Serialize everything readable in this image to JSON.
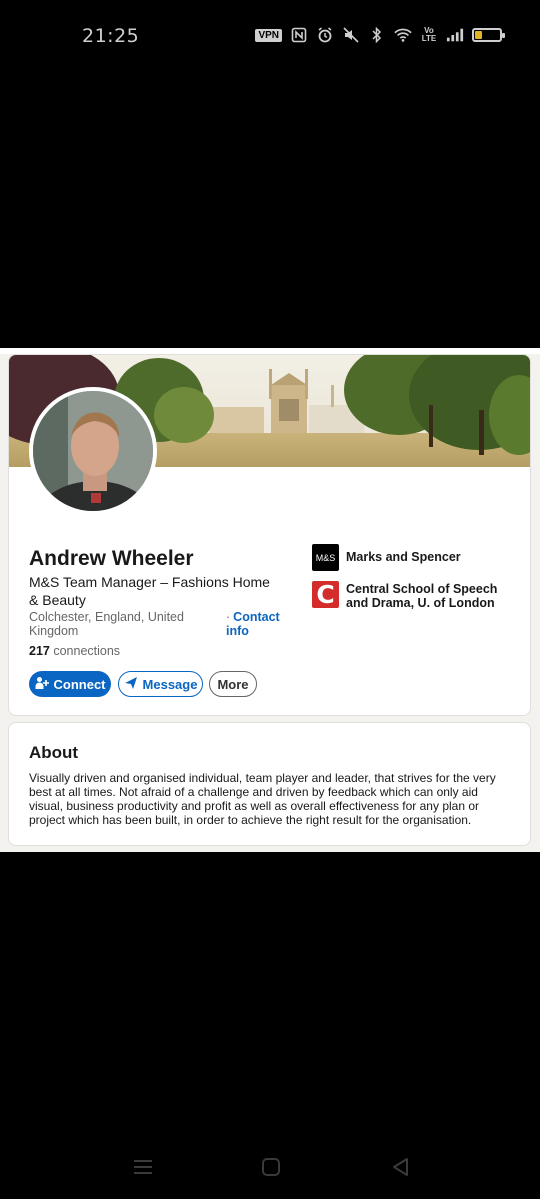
{
  "status_bar": {
    "time": "21:25",
    "vpn_label": "VPN",
    "battery_level_fraction": 0.3,
    "battery_color": "#e0b424",
    "icons": [
      "nfc-icon",
      "alarm-icon",
      "mute-icon",
      "bluetooth-icon",
      "wifi-icon",
      "volte-icon",
      "signal-icon",
      "battery-icon"
    ]
  },
  "profile": {
    "name": "Andrew Wheeler",
    "headline": "M&S Team Manager – Fashions Home & Beauty",
    "location": "Colchester, England, United Kingdom",
    "contact_dot": "·",
    "contact_info_label": "Contact info",
    "connections_count": "217",
    "connections_label": "connections",
    "actions": {
      "connect": "Connect",
      "message": "Message",
      "more": "More"
    },
    "experience": [
      {
        "logo_text": "M&S",
        "name": "Marks and Spencer"
      },
      {
        "logo_text": "C",
        "name": "Central School of Speech and Drama, U. of London"
      }
    ]
  },
  "about": {
    "title": "About",
    "body": "Visually driven and organised individual, team player and leader, that strives for the very best at all times. Not afraid of a challenge and driven by feedback which can only aid visual, business productivity and profit as well as overall effectiveness for any plan or project which has been built, in order to achieve the right result for the organisation."
  },
  "colors": {
    "brand_blue": "#0a66c2",
    "page_bg": "#f4f2ee",
    "cssd_red": "#d42b2b"
  }
}
